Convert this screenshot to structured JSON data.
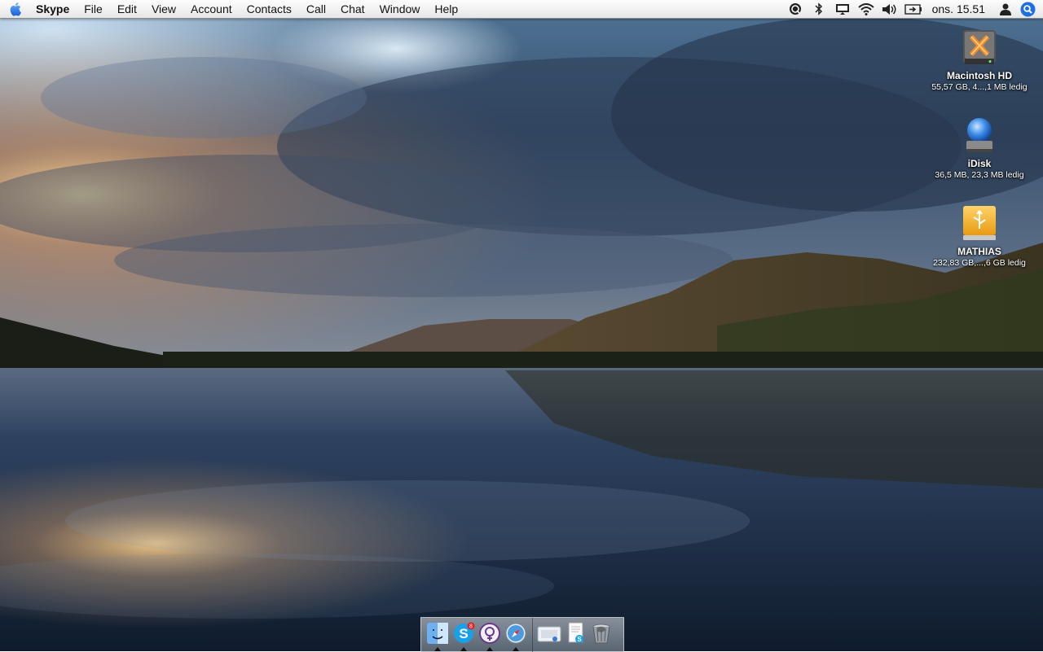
{
  "menubar": {
    "apple_icon": "apple-icon",
    "app_name": "Skype",
    "menus": [
      "File",
      "Edit",
      "View",
      "Account",
      "Contacts",
      "Call",
      "Chat",
      "Window",
      "Help"
    ],
    "status_icons": [
      "skype-status-icon",
      "bluetooth-icon",
      "display-icon",
      "wifi-icon",
      "volume-icon",
      "battery-icon"
    ],
    "clock": "ons. 15.51",
    "user_icon": "user-icon",
    "spotlight_icon": "spotlight-icon"
  },
  "desktop": {
    "icons": [
      {
        "name": "Macintosh HD",
        "info": "55,57 GB, 4...,1 MB ledig",
        "icon": "hard-drive-icon"
      },
      {
        "name": "iDisk",
        "info": "36,5 MB, 23,3 MB ledig",
        "icon": "idisk-icon"
      },
      {
        "name": "MATHIAS",
        "info": "232,83 GB,...,6 GB ledig",
        "icon": "usb-drive-icon"
      }
    ]
  },
  "dock": {
    "apps": [
      {
        "icon": "finder-icon",
        "running": true
      },
      {
        "icon": "skype-icon",
        "running": true,
        "badge": "8"
      },
      {
        "icon": "adium-icon",
        "running": true
      },
      {
        "icon": "safari-icon",
        "running": true
      }
    ],
    "stacks": [
      "preview-stack-icon",
      "documents-stack-icon",
      "trash-icon"
    ]
  },
  "colors": {
    "menubar": "#eeeeee",
    "sky_top": "#6f95b6",
    "sunset": "#f2b46a",
    "water": "#1b2c44"
  }
}
